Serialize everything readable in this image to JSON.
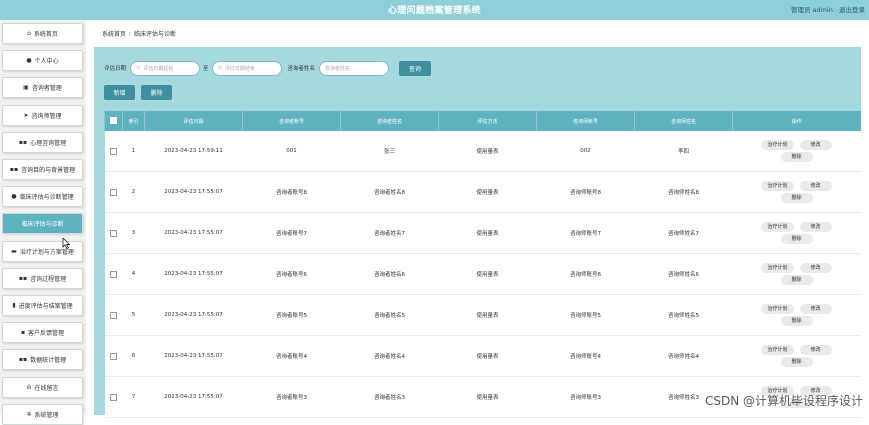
{
  "header": {
    "title": "心理问题档案管理系统",
    "user": "管理员 admin",
    "logout": "退出登录"
  },
  "sidebar": {
    "items": [
      {
        "label": "系统首页",
        "icon": "home-icon",
        "glyph": "⌂"
      },
      {
        "label": "个人中心",
        "icon": "user-icon",
        "glyph": "●"
      },
      {
        "label": "咨询者管理",
        "icon": "contact-card-icon",
        "glyph": "▣"
      },
      {
        "label": "咨询师管理",
        "icon": "send-icon",
        "glyph": "➤"
      },
      {
        "label": "心理咨询管理",
        "icon": "grid-icon",
        "glyph": "▪▪"
      },
      {
        "label": "咨询目的与背景管理",
        "icon": "grid-icon",
        "glyph": "▪▪"
      },
      {
        "label": "临床评估与诊断管理",
        "icon": "user-icon",
        "glyph": "●"
      },
      {
        "label": "临床评估与诊断",
        "icon": "",
        "glyph": ""
      },
      {
        "label": "治疗计划与方案管理",
        "icon": "briefcase-icon",
        "glyph": "▬"
      },
      {
        "label": "咨询过程管理",
        "icon": "grid-icon",
        "glyph": "▪▪"
      },
      {
        "label": "进度评估与结案管理",
        "icon": "chart-icon",
        "glyph": "▮"
      },
      {
        "label": "客户反馈管理",
        "icon": "cart-icon",
        "glyph": "▪"
      },
      {
        "label": "数据统计管理",
        "icon": "grid-icon",
        "glyph": "▪▪"
      },
      {
        "label": "在线留言",
        "icon": "bar-chart-icon",
        "glyph": "ılı"
      },
      {
        "label": "系统管理",
        "icon": "gear-icon",
        "glyph": "✲"
      }
    ],
    "active_index": 7
  },
  "breadcrumb": {
    "home": "系统首页",
    "sep": "⁝",
    "current": "临床评估与诊断"
  },
  "search": {
    "date_label": "评估日期",
    "date_start_placeholder": "评估日期起始",
    "to_label": "至",
    "date_end_placeholder": "评估日期结束",
    "name_label": "咨询者姓名",
    "name_placeholder": "咨询者姓名",
    "search_button": "查询"
  },
  "actions": {
    "add": "新增",
    "delete": "删除"
  },
  "table": {
    "columns": [
      "",
      "索引",
      "评估日期",
      "咨询者账号",
      "咨询者姓名",
      "评估方法",
      "咨询师账号",
      "咨询师姓名",
      "操作"
    ],
    "op_labels": [
      "治疗计划",
      "修改",
      "删除"
    ],
    "rows": [
      [
        "1",
        "2023-04-23 17:59:11",
        "001",
        "张三",
        "使用量表",
        "002",
        "李四"
      ],
      [
        "2",
        "2023-04-23 17:55:07",
        "咨询者账号8",
        "咨询者姓名8",
        "使用量表",
        "咨询师账号8",
        "咨询师姓名8"
      ],
      [
        "3",
        "2023-04-23 17:55:07",
        "咨询者账号7",
        "咨询者姓名7",
        "使用量表",
        "咨询师账号7",
        "咨询师姓名7"
      ],
      [
        "4",
        "2023-04-23 17:55:07",
        "咨询者账号6",
        "咨询者姓名6",
        "使用量表",
        "咨询师账号6",
        "咨询师姓名6"
      ],
      [
        "5",
        "2023-04-23 17:55:07",
        "咨询者账号5",
        "咨询者姓名5",
        "使用量表",
        "咨询师账号5",
        "咨询师姓名5"
      ],
      [
        "6",
        "2023-04-23 17:55:07",
        "咨询者账号4",
        "咨询者姓名4",
        "使用量表",
        "咨询师账号4",
        "咨询师姓名4"
      ],
      [
        "7",
        "2023-04-23 17:55:07",
        "咨询者账号3",
        "咨询者姓名3",
        "使用量表",
        "咨询师账号3",
        "咨询师姓名3"
      ]
    ]
  },
  "watermark": "CSDN @计算机毕设程序设计",
  "colors": {
    "header": "#8fcfd8",
    "accent": "#3f8f9e",
    "table_header": "#5fb3c0",
    "panel": "#a6d9df"
  }
}
